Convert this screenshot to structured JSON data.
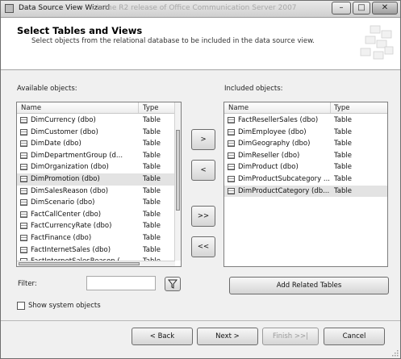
{
  "window": {
    "title": "Data Source View Wizard",
    "background_title": "...is the R2 release of Office Communication Server 2007"
  },
  "header": {
    "title": "Select Tables and Views",
    "subtitle": "Select objects from the relational database to be included in the data source view."
  },
  "available": {
    "label": "Available objects:",
    "col_name": "Name",
    "col_type": "Type",
    "rows": [
      {
        "name": "DimCurrency (dbo)",
        "type": "Table"
      },
      {
        "name": "DimCustomer (dbo)",
        "type": "Table"
      },
      {
        "name": "DimDate (dbo)",
        "type": "Table"
      },
      {
        "name": "DimDepartmentGroup (d...",
        "type": "Table"
      },
      {
        "name": "DimOrganization (dbo)",
        "type": "Table"
      },
      {
        "name": "DimPromotion (dbo)",
        "type": "Table"
      },
      {
        "name": "DimSalesReason (dbo)",
        "type": "Table"
      },
      {
        "name": "DimScenario (dbo)",
        "type": "Table"
      },
      {
        "name": "FactCallCenter (dbo)",
        "type": "Table"
      },
      {
        "name": "FactCurrencyRate (dbo)",
        "type": "Table"
      },
      {
        "name": "FactFinance (dbo)",
        "type": "Table"
      },
      {
        "name": "FactInternetSales (dbo)",
        "type": "Table"
      },
      {
        "name": "FactInternetSalesReason (...",
        "type": "Table"
      }
    ]
  },
  "included": {
    "label": "Included objects:",
    "col_name": "Name",
    "col_type": "Type",
    "rows": [
      {
        "name": "FactResellerSales (dbo)",
        "type": "Table"
      },
      {
        "name": "DimEmployee (dbo)",
        "type": "Table"
      },
      {
        "name": "DimGeography (dbo)",
        "type": "Table"
      },
      {
        "name": "DimReseller (dbo)",
        "type": "Table"
      },
      {
        "name": "DimProduct (dbo)",
        "type": "Table"
      },
      {
        "name": "DimProductSubcategory ...",
        "type": "Table"
      },
      {
        "name": "DimProductCategory (db...",
        "type": "Table"
      }
    ]
  },
  "move_buttons": {
    "add": ">",
    "remove": "<",
    "add_all": ">>",
    "remove_all": "<<"
  },
  "filter": {
    "label": "Filter:",
    "value": "",
    "placeholder": ""
  },
  "add_related_label": "Add Related Tables",
  "show_system_label": "Show system objects",
  "nav": {
    "back": "< Back",
    "next": "Next >",
    "finish": "Finish >>|",
    "cancel": "Cancel"
  }
}
